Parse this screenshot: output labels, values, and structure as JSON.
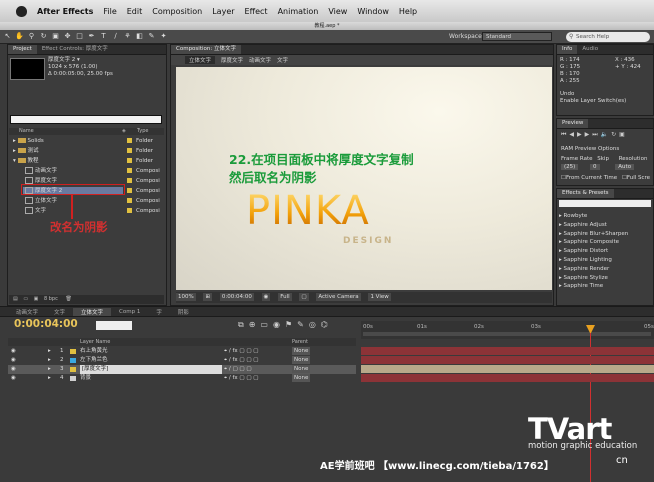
{
  "menubar": {
    "app_name": "After Effects",
    "items": [
      "File",
      "Edit",
      "Composition",
      "Layer",
      "Effect",
      "Animation",
      "View",
      "Window",
      "Help"
    ]
  },
  "window_title": "教程.aep *",
  "toolbar": {
    "workspace_label": "Workspace:",
    "workspace_value": "Standard",
    "search_placeholder": "Search Help"
  },
  "project_panel": {
    "tabs": [
      "Project",
      "Effect Controls: 厚度文字"
    ],
    "selected_name": "厚度文字 2 ▾",
    "selected_dims": "1024 x 576 (1.00)",
    "selected_duration": "Δ 0:00:05:00, 25.00 fps",
    "col_name": "Name",
    "col_type": "Type",
    "items": [
      {
        "name": "Solids",
        "type": "Folder",
        "kind": "folder",
        "indent": 0
      },
      {
        "name": "测试",
        "type": "Folder",
        "kind": "folder",
        "indent": 0
      },
      {
        "name": "教程",
        "type": "Folder",
        "kind": "folder",
        "indent": 0
      },
      {
        "name": "动画文字",
        "type": "Composi",
        "kind": "comp",
        "indent": 1
      },
      {
        "name": "厚度文字",
        "type": "Composi",
        "kind": "comp",
        "indent": 1
      },
      {
        "name": "厚度文字 2",
        "type": "Composi",
        "kind": "comp",
        "indent": 1,
        "selected": true
      },
      {
        "name": "立体文字",
        "type": "Composi",
        "kind": "comp",
        "indent": 1
      },
      {
        "name": "文字",
        "type": "Composi",
        "kind": "comp",
        "indent": 1
      }
    ],
    "bpc": "8 bpc"
  },
  "comp_panel": {
    "tab": "Composition: 立体文字",
    "breadcrumbs": [
      "立体文字",
      "厚度文字",
      "动画文字",
      "文字"
    ],
    "zoom": "100%",
    "timecode": "0:00:04:00",
    "resolution": "Full",
    "camera": "Active Camera",
    "view": "1 View"
  },
  "annotations": {
    "step_line1": "22.在项目面板中将厚度文字复制",
    "step_line2": "然后取名为阴影",
    "rename": "改名为阴影"
  },
  "artwork": {
    "logo": "PINKA",
    "sub": "DESIGN"
  },
  "info_panel": {
    "tabs": [
      "Info",
      "Audio"
    ],
    "r": "R : 174",
    "g": "G : 175",
    "b": "B : 170",
    "a": "A : 255",
    "x": "X : 436",
    "y": "+ Y : 424",
    "undo_label": "Undo",
    "undo_action": "Enable Layer Switch(es)"
  },
  "preview_panel": {
    "tab": "Preview",
    "ram_options": "RAM Preview Options",
    "frame_rate_label": "Frame Rate",
    "skip_label": "Skip",
    "resolution_label": "Resolution",
    "frame_rate": "(25)",
    "skip": "0",
    "resolution": "Auto",
    "from_current": "From Current Time",
    "full_screen": "Full Scre"
  },
  "effects_panel": {
    "tab": "Effects & Presets",
    "items": [
      "Rowbyte",
      "Sapphire Adjust",
      "Sapphire Blur+Sharpen",
      "Sapphire Composite",
      "Sapphire Distort",
      "Sapphire Lighting",
      "Sapphire Render",
      "Sapphire Stylize",
      "Sapphire Time"
    ]
  },
  "timeline": {
    "tabs": [
      "动画文字",
      "文字",
      "立体文字",
      "Comp 1",
      "字",
      "阴影"
    ],
    "timecode": "0:00:04:00",
    "layer_col": "Layer Name",
    "parent_col": "Parent",
    "layers": [
      {
        "num": "1",
        "name": "右上角黄光",
        "color": "#e0c040",
        "parent": "None"
      },
      {
        "num": "2",
        "name": "左下角兰色",
        "color": "#3aa9e0",
        "parent": "None"
      },
      {
        "num": "3",
        "name": "[厚度文字]",
        "color": "#e0c040",
        "parent": "None",
        "selected": true
      },
      {
        "num": "4",
        "name": "背景",
        "color": "#d0d0d0",
        "parent": "None"
      }
    ],
    "ruler": [
      "00s",
      "01s",
      "02s",
      "03s",
      "",
      "05s"
    ]
  },
  "watermark": {
    "brand": "TVart",
    "tagline": "motion graphic education",
    "url": "AE学前班吧  【www.linecg.com/tieba/1762】",
    "cn": "cn"
  },
  "colors": {
    "accent_red": "#d02020",
    "annotation_green": "#1a9b3a",
    "timecode": "#e8c45a",
    "layer_bar": "#8c3337"
  }
}
